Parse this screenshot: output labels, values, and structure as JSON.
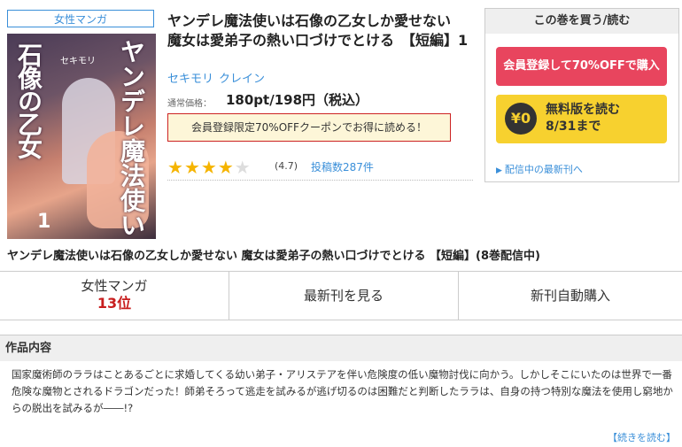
{
  "product": {
    "genre_tag": "女性マンガ",
    "title": "ヤンデレ魔法使いは石像の乙女しか愛せない　魔女は愛弟子の熱い口づけでとける　【短編】1",
    "authors": [
      "セキモリ",
      "クレイン"
    ],
    "price_label": "通常価格：",
    "price": "180pt/198円（税込）",
    "coupon_text": "会員登録限定70%OFFクーポンでお得に読める！",
    "rating_stars": 4.7,
    "rating_text": "(4.7)",
    "reviews_text": "投稿数287件",
    "full_title": "ヤンデレ魔法使いは石像の乙女しか愛せない 魔女は愛弟子の熱い口づけでとける 【短編】(8巻配信中)",
    "cover": {
      "title_left": "石像の乙女",
      "title_right": "ヤンデレ魔法使い",
      "author": "セキモリ",
      "volume": "1"
    }
  },
  "buybox": {
    "header": "この巻を買う/読む",
    "register_button": "会員登録して70%OFFで購入",
    "free_yen": "¥0",
    "free_line1": "無料版を読む",
    "free_line2": "8/31まで",
    "latest_link": "配信中の最新刊へ"
  },
  "tabs": {
    "ranking_genre": "女性マンガ",
    "ranking_rank": "13位",
    "latest": "最新刊を見る",
    "auto_buy": "新刊自動購入"
  },
  "description": {
    "heading": "作品内容",
    "text": "国家魔術師のララはことあるごとに求婚してくる幼い弟子・アリステアを伴い危険度の低い魔物討伐に向かう。しかしそこにいたのは世界で一番危険な魔物とされるドラゴンだった！師弟そろって逃走を試みるが逃げ切るのは困難だと判断したララは、自身の持つ特別な魔法を使用し窮地からの脱出を試みるが――!?",
    "more_link": "【続きを読む】"
  },
  "colors": {
    "accent_blue": "#3a8fd9",
    "register_red": "#e8455e",
    "free_yellow": "#f7d12f",
    "rank_red": "#c81e1e",
    "star": "#f5b400"
  }
}
